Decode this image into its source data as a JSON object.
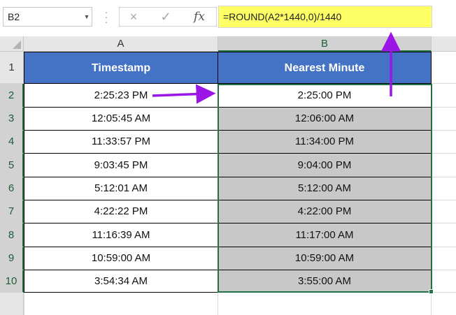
{
  "name_box": {
    "value": "B2"
  },
  "formula_bar": {
    "cancel_icon": "×",
    "enter_icon": "✓",
    "fx_label": "fx",
    "formula": "=ROUND(A2*1440,0)/1440"
  },
  "columns": [
    "A",
    "B"
  ],
  "rows": [
    "1",
    "2",
    "3",
    "4",
    "5",
    "6",
    "7",
    "8",
    "9",
    "10"
  ],
  "header": {
    "timestamp": "Timestamp",
    "nearest_minute": "Nearest Minute"
  },
  "data": [
    {
      "timestamp": "2:25:23 PM",
      "nearest": "2:25:00 PM"
    },
    {
      "timestamp": "12:05:45 AM",
      "nearest": "12:06:00 AM"
    },
    {
      "timestamp": "11:33:57 PM",
      "nearest": "11:34:00 PM"
    },
    {
      "timestamp": "9:03:45 PM",
      "nearest": "9:04:00 PM"
    },
    {
      "timestamp": "5:12:01 AM",
      "nearest": "5:12:00 AM"
    },
    {
      "timestamp": "4:22:22 PM",
      "nearest": "4:22:00 PM"
    },
    {
      "timestamp": "11:16:39 AM",
      "nearest": "11:17:00 AM"
    },
    {
      "timestamp": "10:59:00 AM",
      "nearest": "10:59:00 AM"
    },
    {
      "timestamp": "3:54:34 AM",
      "nearest": "3:55:00 AM"
    }
  ],
  "colors": {
    "header_fill": "#4472c4",
    "selection": "#217346",
    "formula_highlight": "#ffff66",
    "arrow": "#9b16e6"
  }
}
